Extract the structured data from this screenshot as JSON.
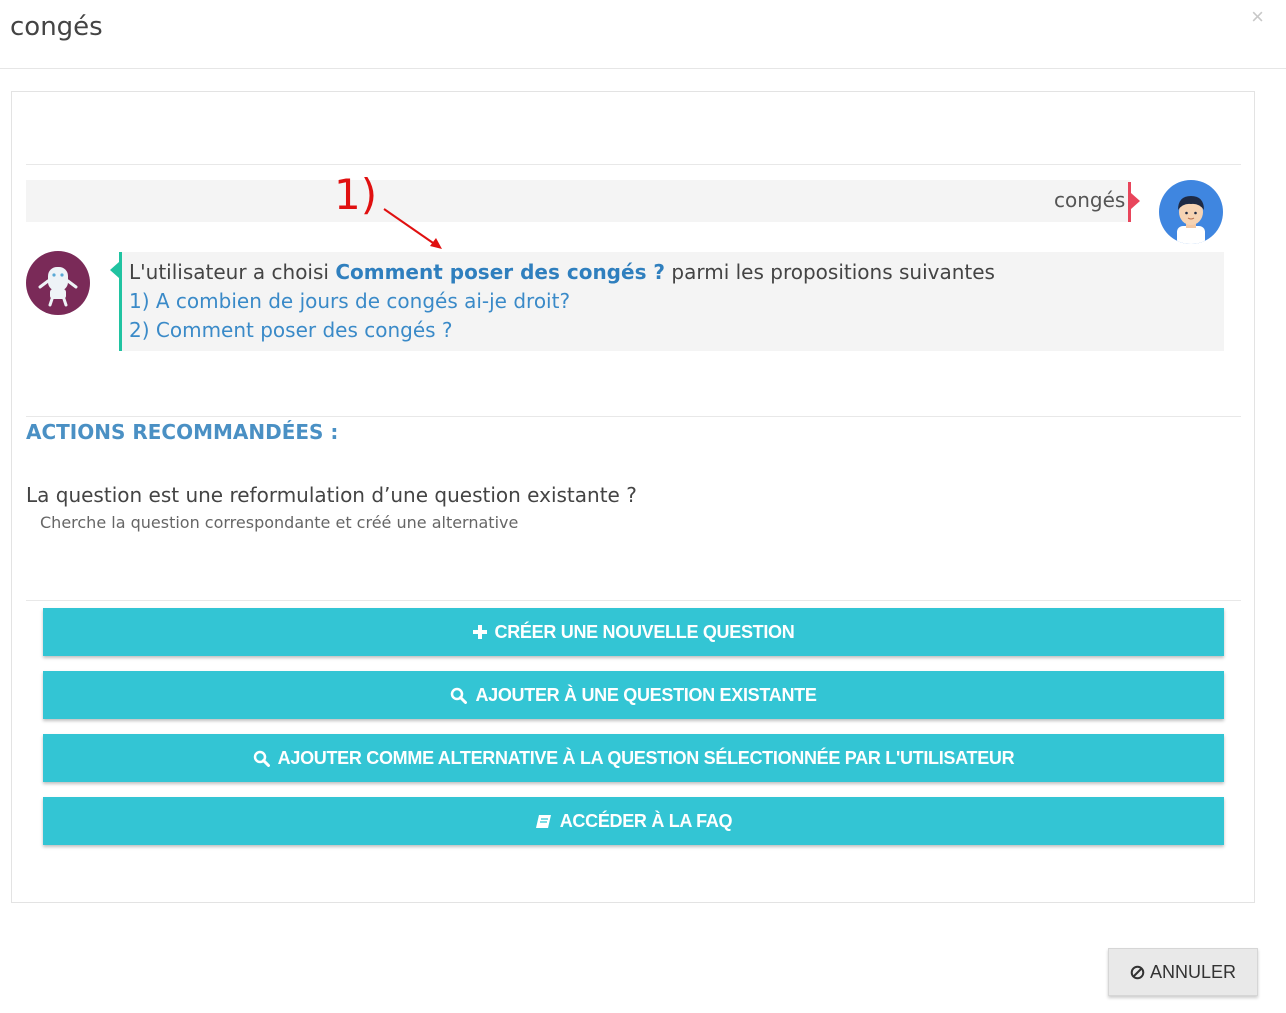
{
  "modal": {
    "title": "congés",
    "close": "×"
  },
  "conversation": {
    "user_message": "congés",
    "bot_prefix": "L'utilisateur a choisi ",
    "bot_selected": "Comment poser des congés ?",
    "bot_suffix": " parmi les propositions suivantes",
    "options": [
      "1) A combien de jours de congés ai-je droit?",
      "2) Comment poser des congés ?"
    ]
  },
  "annotation": {
    "label": "1)",
    "color": "#e01010"
  },
  "recommended": {
    "title": "ACTIONS RECOMMANDÉES :",
    "question": "La question est une reformulation d’une question existante ?",
    "hint": "Cherche la question correspondante et créé une alternative"
  },
  "actions": [
    {
      "label": "CRÉER UNE NOUVELLE QUESTION",
      "icon": "plus-icon"
    },
    {
      "label": "AJOUTER À UNE QUESTION EXISTANTE",
      "icon": "search-icon"
    },
    {
      "label": "AJOUTER COMME ALTERNATIVE À LA QUESTION SÉLECTIONNÉE PAR L'UTILISATEUR",
      "icon": "search-icon"
    },
    {
      "label": "ACCÉDER À LA FAQ",
      "icon": "book-icon"
    }
  ],
  "footer": {
    "cancel_label": "ANNULER",
    "cancel_icon": "ban-icon"
  },
  "colors": {
    "accent": "#33c5d4",
    "link": "#3a8ac8",
    "bot_border": "#20c3a1",
    "user_flag": "#e8455b",
    "section_title": "#4a90c4"
  }
}
